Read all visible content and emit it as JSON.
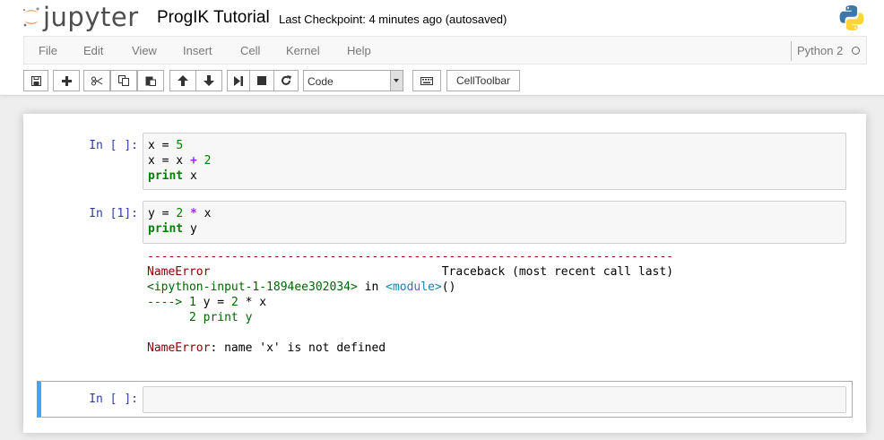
{
  "header": {
    "logo_text": "jupyter",
    "notebook_name": "ProgIK Tutorial",
    "checkpoint": "Last Checkpoint: 4 minutes ago (autosaved)"
  },
  "menu": {
    "items": [
      "File",
      "Edit",
      "View",
      "Insert",
      "Cell",
      "Kernel",
      "Help"
    ],
    "kernel_name": "Python 2"
  },
  "toolbar": {
    "cell_type": "Code",
    "celltoolbar_label": "CellToolbar",
    "icons": [
      "save-icon",
      "plus-icon",
      "cut-icon",
      "copy-icon",
      "paste-icon",
      "arrow-up-icon",
      "arrow-down-icon",
      "step-forward-icon",
      "stop-icon",
      "restart-icon",
      "keyboard-icon"
    ]
  },
  "cells": [
    {
      "prompt": "In [ ]:",
      "lines": [
        "x = 5",
        "x = x + 2",
        "print x"
      ]
    },
    {
      "prompt": "In [1]:",
      "lines": [
        "y = 2 * x",
        "print y"
      ]
    },
    {
      "prompt": "In [ ]:",
      "lines": []
    }
  ],
  "output": {
    "dashes": "---------------------------------------------------------------------------",
    "error_name": "NameError",
    "traceback_header": "Traceback (most recent call last)",
    "input_ref": "<ipython-input-1-1894ee302034>",
    "in_word": "in",
    "module": "<module>",
    "paren": "()",
    "arrow_line_prefix": "----> 1 ",
    "arrow_line_code": "y = 2 * x",
    "line2": "      2 print y",
    "final_message": ": name 'x' is not defined"
  },
  "colors": {
    "accent": "#42a5f5",
    "prompt": "#303f9f",
    "error": "#8b0000",
    "keyword": "#008000"
  }
}
